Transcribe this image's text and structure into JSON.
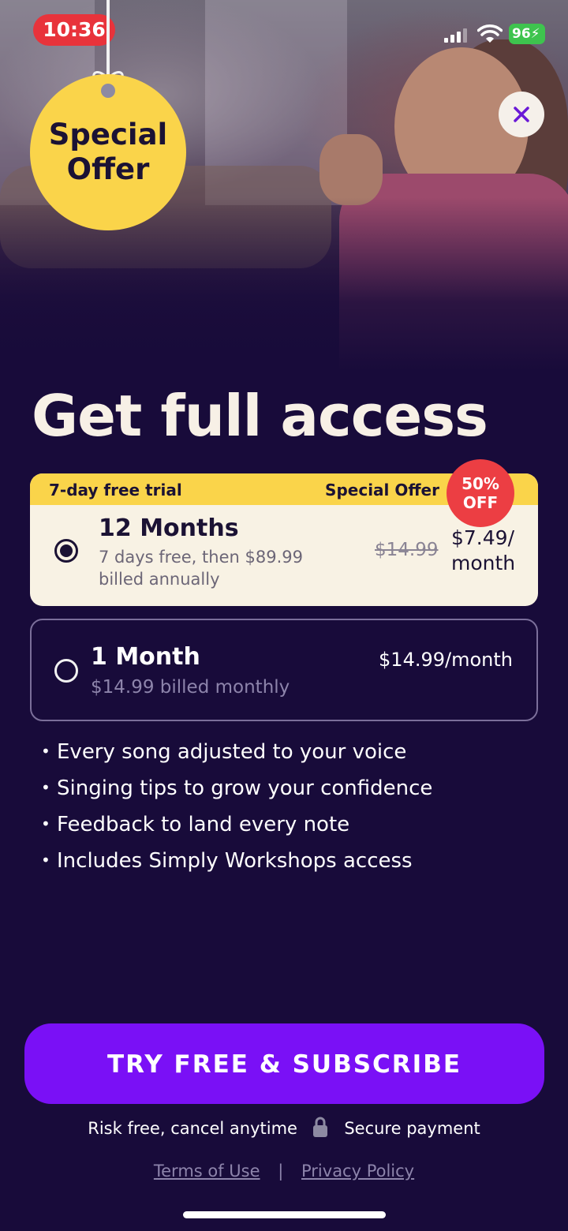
{
  "status_bar": {
    "time": "10:36",
    "battery": "96"
  },
  "tag": {
    "line1": "Special",
    "line2": "Offer"
  },
  "title": "Get full access",
  "plans": {
    "selected": {
      "trial_label": "7-day free trial",
      "offer_label": "Special Offer",
      "discount_line1": "50%",
      "discount_line2": "OFF",
      "name": "12 Months",
      "desc": "7 days free, then $89.99 billed annually",
      "old_price": "$14.99",
      "price_line1": "$7.49/",
      "price_line2": "month"
    },
    "other": {
      "name": "1 Month",
      "desc": "$14.99 billed monthly",
      "price": "$14.99/month"
    }
  },
  "features": [
    "Every song adjusted to your voice",
    "Singing tips to grow your confidence",
    "Feedback to land every note",
    "Includes Simply Workshops access"
  ],
  "cta_label": "TRY FREE & SUBSCRIBE",
  "assurance": {
    "left": "Risk free, cancel anytime",
    "right": "Secure payment"
  },
  "legal": {
    "terms": "Terms of Use",
    "separator": "|",
    "privacy": "Privacy Policy"
  },
  "colors": {
    "background": "#180b3a",
    "accent_yellow": "#fad44a",
    "cta_purple": "#7a10f6",
    "discount_red": "#ec3e43",
    "time_pill_red": "#e8333b"
  }
}
